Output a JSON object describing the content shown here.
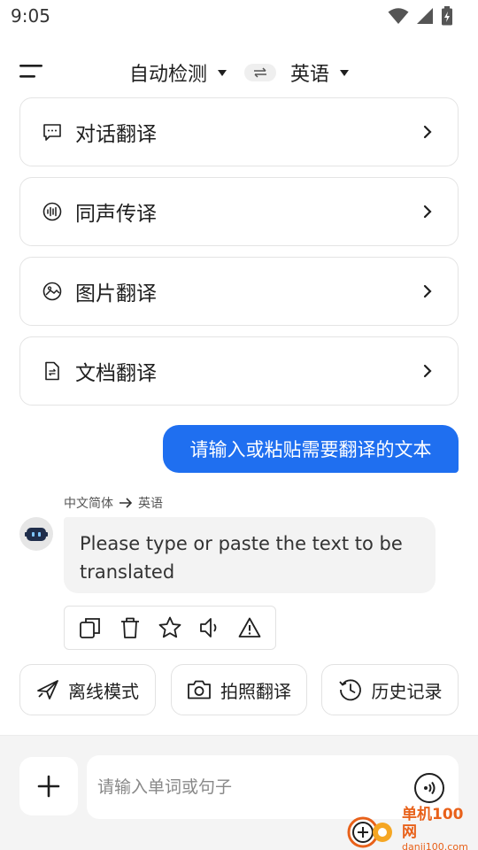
{
  "status": {
    "time": "9:05"
  },
  "header": {
    "source_lang": "自动检测",
    "target_lang": "英语"
  },
  "cards": [
    {
      "label": "对话翻译",
      "icon": "chat-bubble-icon"
    },
    {
      "label": "同声传译",
      "icon": "sound-wave-icon"
    },
    {
      "label": "图片翻译",
      "icon": "image-icon"
    },
    {
      "label": "文档翻译",
      "icon": "document-icon"
    }
  ],
  "chat": {
    "user_message": "请输入或粘贴需要翻译的文本",
    "direction_from": "中文简体",
    "direction_to": "英语",
    "bot_message": "Please type or paste the text to be translated"
  },
  "features": [
    {
      "label": "离线模式",
      "icon": "airplane-icon"
    },
    {
      "label": "拍照翻译",
      "icon": "camera-icon"
    },
    {
      "label": "历史记录",
      "icon": "history-icon"
    }
  ],
  "input": {
    "placeholder": "请输入单词或句子"
  },
  "watermark": {
    "site_name": "单机100网",
    "url": "danji100.com"
  }
}
